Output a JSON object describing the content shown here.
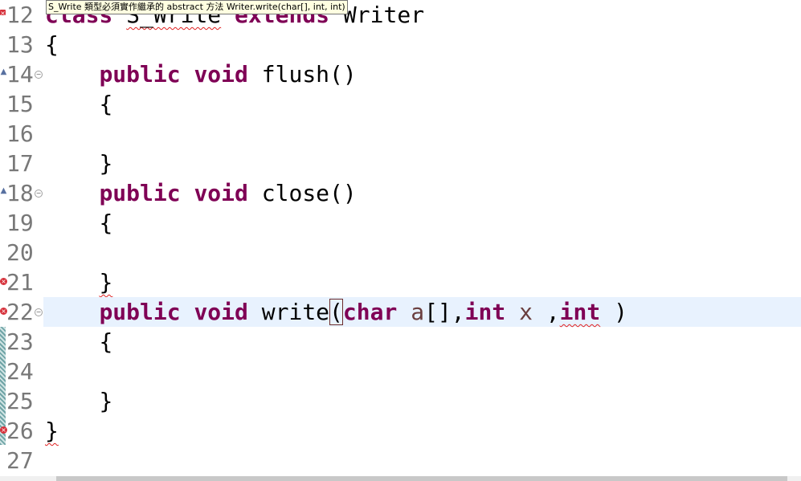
{
  "tooltip": {
    "text": "S_Write 類型必須實作繼承的 abstract 方法 Writer.write(char[], int, int)"
  },
  "lines": [
    {
      "num": "12",
      "kw1": "class",
      "name": "S_Write",
      "kw2": "extends",
      "rest": "Writer"
    },
    {
      "num": "13",
      "text": "{"
    },
    {
      "num": "14",
      "kw1": "public",
      "kw2": "void",
      "method": "flush()"
    },
    {
      "num": "15",
      "text": "{"
    },
    {
      "num": "16",
      "text": ""
    },
    {
      "num": "17",
      "text": "}"
    },
    {
      "num": "18",
      "kw1": "public",
      "kw2": "void",
      "method": "close()"
    },
    {
      "num": "19",
      "text": "{"
    },
    {
      "num": "20",
      "text": ""
    },
    {
      "num": "21",
      "text": "}"
    },
    {
      "num": "22",
      "kw1": "public",
      "kw2": "void",
      "method": "write",
      "open_paren": "(",
      "kw3": "char",
      "param": "a",
      "p2": "[],",
      "kw4": "int",
      "param2": "x",
      "p3": " ,",
      "kw5": "int",
      "p4": " )"
    },
    {
      "num": "23",
      "text": "{"
    },
    {
      "num": "24",
      "text": ""
    },
    {
      "num": "25",
      "text": "}"
    },
    {
      "num": "26",
      "text": "}"
    },
    {
      "num": "27",
      "text": ""
    }
  ],
  "markers": {
    "error_icon": "error-x-icon",
    "override_icon": "override-triangle-icon",
    "fold_icon": "fold-minus-icon",
    "error_color": "#d6303a",
    "keyword_color": "#7f0055",
    "param_color": "#6a3e3e",
    "current_line_color": "#e8f2fe"
  }
}
